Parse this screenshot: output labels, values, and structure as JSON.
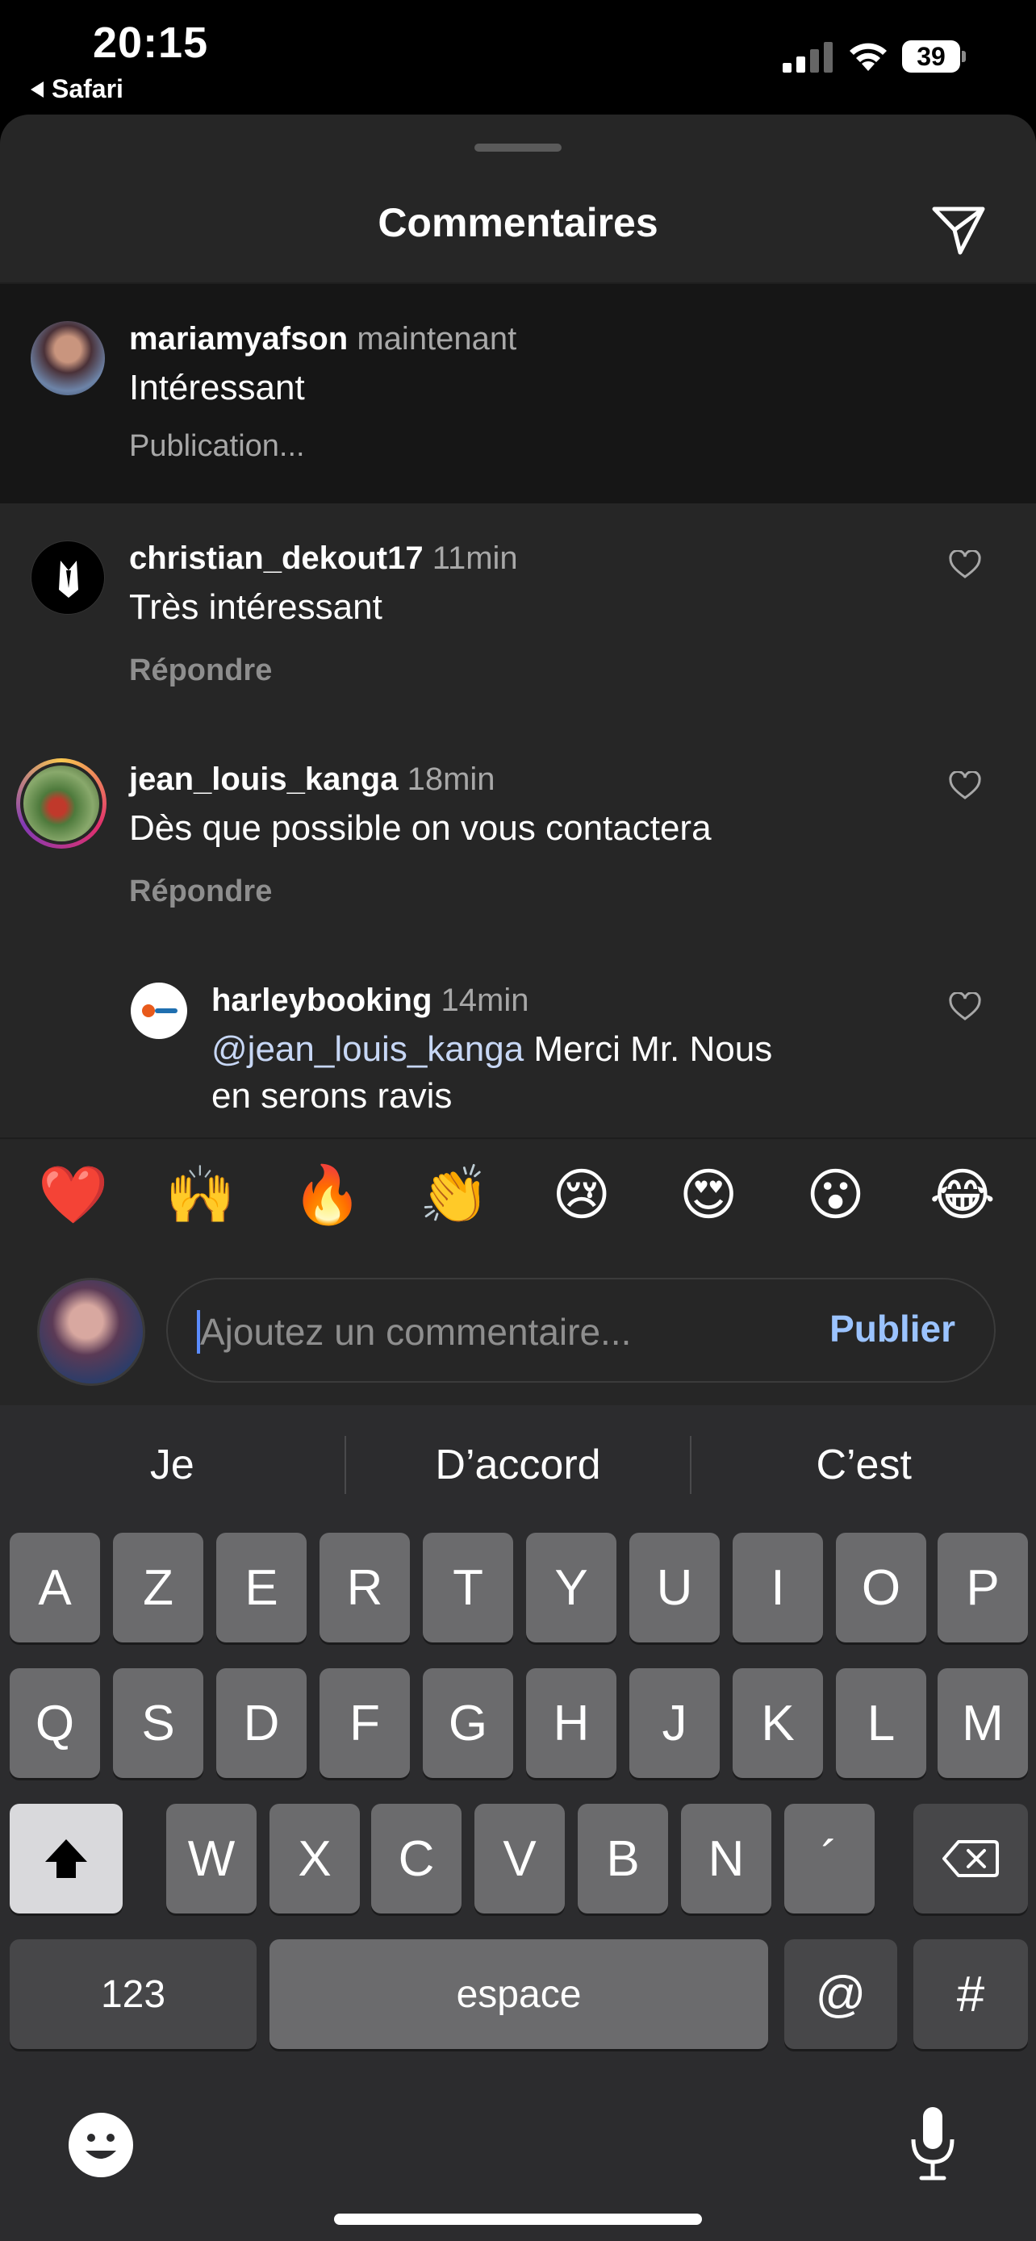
{
  "status_bar": {
    "time": "20:15",
    "back_app": "Safari",
    "battery": "39"
  },
  "sheet": {
    "title": "Commentaires"
  },
  "comments": [
    {
      "user": "mariamyafson",
      "time": "maintenant",
      "text": "Intéressant",
      "status": "Publication..."
    },
    {
      "user": "christian_dekout17",
      "time": "11min",
      "text": "Très intéressant",
      "reply": "Répondre"
    },
    {
      "user": "jean_louis_kanga",
      "time": "18min",
      "text": "Dès que possible on vous contactera",
      "reply": "Répondre"
    },
    {
      "user": "harleybooking",
      "time": "14min",
      "mention": "@jean_louis_kanga",
      "text": " Merci Mr. Nous",
      "text2": "en serons ravis"
    }
  ],
  "emojis": [
    "❤️",
    "🙌",
    "🔥",
    "👏",
    "😢",
    "😍",
    "😮",
    "😂"
  ],
  "composer": {
    "placeholder": "Ajoutez un commentaire...",
    "publish": "Publier"
  },
  "keyboard": {
    "predictions": [
      "Je",
      "D’accord",
      "C’est"
    ],
    "row1": [
      "A",
      "Z",
      "E",
      "R",
      "T",
      "Y",
      "U",
      "I",
      "O",
      "P"
    ],
    "row2": [
      "Q",
      "S",
      "D",
      "F",
      "G",
      "H",
      "J",
      "K",
      "L",
      "M"
    ],
    "row3": [
      "W",
      "X",
      "C",
      "V",
      "B",
      "N",
      "´"
    ],
    "numbers": "123",
    "space": "espace",
    "at": "@",
    "hash": "#"
  },
  "colors": {
    "sheet_bg": "#262626",
    "highlight_bg": "#161616",
    "link_blue": "#9bc3ff",
    "keyboard_bg": "#2c2c2e"
  }
}
